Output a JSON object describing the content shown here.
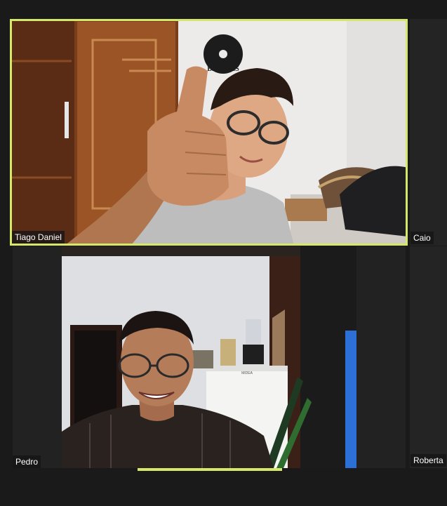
{
  "participants": {
    "tiago": {
      "name": "Tiago Daniel",
      "active_speaker": true
    },
    "caio": {
      "name": "Caio"
    },
    "pedro": {
      "name": "Pedro"
    },
    "roberta": {
      "name": "Roberta"
    }
  },
  "video_content": {
    "wall_decor_text": "BEATLES",
    "fridge_brand": "MIDEA"
  },
  "colors": {
    "active_speaker_border": "#d6e86a",
    "background": "#1a1a1a",
    "name_label_bg": "#141414"
  }
}
